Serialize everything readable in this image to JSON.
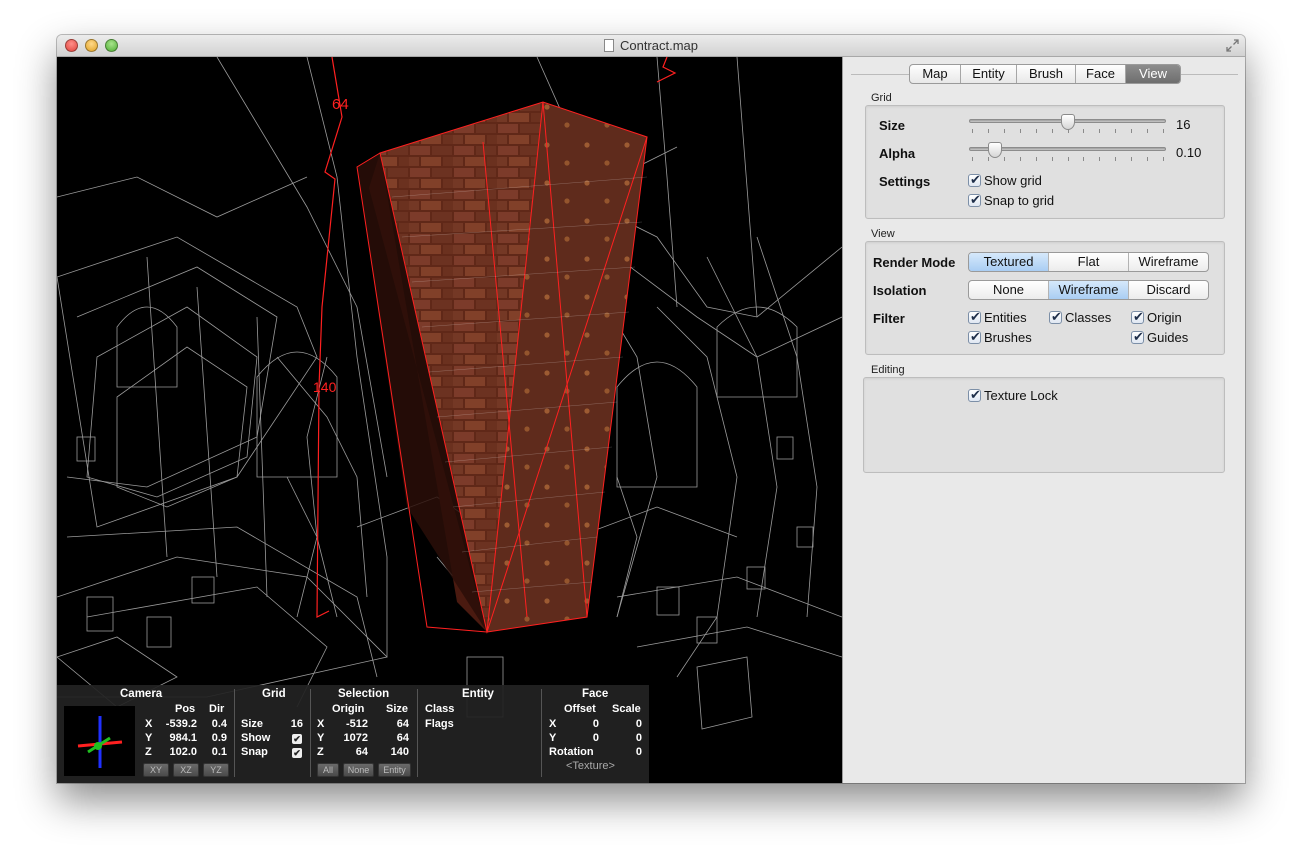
{
  "window": {
    "title": "Contract.map"
  },
  "viewport": {
    "measure_top": "64",
    "measure_side": "140"
  },
  "statusbar": {
    "camera": {
      "title": "Camera",
      "pos_label": "Pos",
      "dir_label": "Dir",
      "rows": [
        {
          "axis": "X",
          "pos": "-539.2",
          "dir": "0.4"
        },
        {
          "axis": "Y",
          "pos": "984.1",
          "dir": "0.9"
        },
        {
          "axis": "Z",
          "pos": "102.0",
          "dir": "0.1"
        }
      ],
      "buttons": [
        "XY",
        "XZ",
        "YZ"
      ]
    },
    "grid": {
      "title": "Grid",
      "size_label": "Size",
      "size_value": "16",
      "show_label": "Show",
      "snap_label": "Snap"
    },
    "selection": {
      "title": "Selection",
      "origin_label": "Origin",
      "size_label": "Size",
      "rows": [
        {
          "axis": "X",
          "origin": "-512",
          "size": "64"
        },
        {
          "axis": "Y",
          "origin": "1072",
          "size": "64"
        },
        {
          "axis": "Z",
          "origin": "64",
          "size": "140"
        }
      ],
      "buttons": [
        "All",
        "None",
        "Entity"
      ]
    },
    "entity": {
      "title": "Entity",
      "class_label": "Class",
      "flags_label": "Flags"
    },
    "face": {
      "title": "Face",
      "offset_label": "Offset",
      "scale_label": "Scale",
      "rows": [
        {
          "axis": "X",
          "offset": "0",
          "scale": "0"
        },
        {
          "axis": "Y",
          "offset": "0",
          "scale": "0"
        }
      ],
      "rotation_label": "Rotation",
      "rotation_value": "0",
      "texture": "<Texture>"
    }
  },
  "inspector": {
    "tabs": [
      "Map",
      "Entity",
      "Brush",
      "Face",
      "View"
    ],
    "active_tab": "View",
    "grid_group": {
      "label": "Grid",
      "size_label": "Size",
      "size_value": "16",
      "size_fraction": 0.5,
      "alpha_label": "Alpha",
      "alpha_value": "0.10",
      "alpha_fraction": 0.13,
      "settings_label": "Settings",
      "show_grid": "Show grid",
      "snap_to_grid": "Snap to grid"
    },
    "view_group": {
      "label": "View",
      "render_mode_label": "Render Mode",
      "render_modes": [
        "Textured",
        "Flat",
        "Wireframe"
      ],
      "render_selected": "Textured",
      "isolation_label": "Isolation",
      "isolation_modes": [
        "None",
        "Wireframe",
        "Discard"
      ],
      "isolation_selected": "Wireframe",
      "filter_label": "Filter",
      "filters": {
        "entities": "Entities",
        "classes": "Classes",
        "origin": "Origin",
        "brushes": "Brushes",
        "guides": "Guides"
      }
    },
    "editing_group": {
      "label": "Editing",
      "texture_lock": "Texture Lock"
    }
  },
  "colors": {
    "selection_red": "#ff2020",
    "wire_gray": "#d0d0d0",
    "selected_segment": "#a9cdf3",
    "active_tab": "#7a7a7a"
  }
}
